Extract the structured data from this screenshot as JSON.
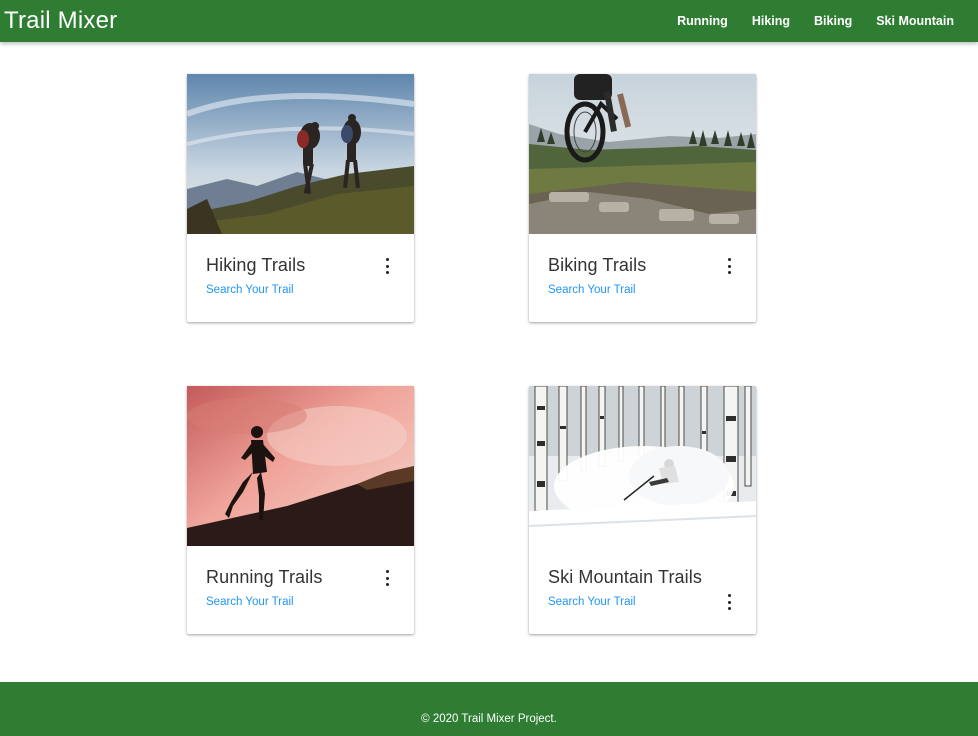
{
  "navbar": {
    "brand": "Trail Mixer",
    "links": [
      "Running",
      "Hiking",
      "Biking",
      "Ski Mountain"
    ],
    "color": "#2e7d32"
  },
  "cards": [
    {
      "title": "Hiking Trails",
      "link": "Search Your Trail",
      "image": "hikers-on-ridge-photo"
    },
    {
      "title": "Biking Trails",
      "link": "Search Your Trail",
      "image": "mountain-biker-photo"
    },
    {
      "title": "Running Trails",
      "link": "Search Your Trail",
      "image": "runner-silhouette-photo"
    },
    {
      "title": "Ski Mountain Trails",
      "link": "Search Your Trail",
      "image": "skier-in-aspens-photo"
    }
  ],
  "footer": {
    "text": "© 2020 Trail Mixer Project.",
    "color": "#2e7d32"
  },
  "accent": "#2196f3"
}
